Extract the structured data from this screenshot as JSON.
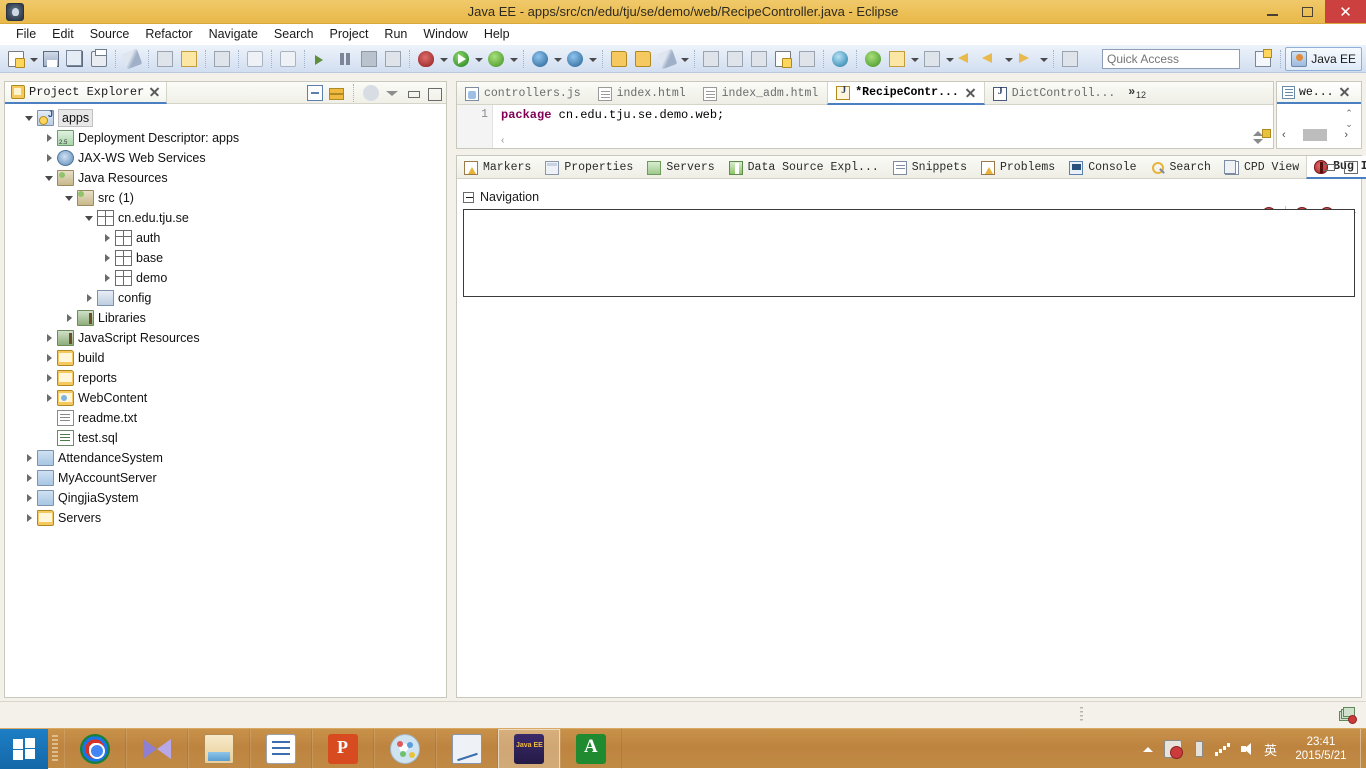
{
  "window": {
    "title": "Java EE - apps/src/cn/edu/tju/se/demo/web/RecipeController.java - Eclipse",
    "app_icon": "eclipse-icon",
    "minimize_label": "Minimize",
    "maximize_label": "Maximize",
    "close_label": "Close",
    "titlebar_color": "#ecc057",
    "close_button_color": "#cc4040"
  },
  "menubar": {
    "items": [
      {
        "label": "File"
      },
      {
        "label": "Edit"
      },
      {
        "label": "Source"
      },
      {
        "label": "Refactor"
      },
      {
        "label": "Navigate"
      },
      {
        "label": "Search"
      },
      {
        "label": "Project"
      },
      {
        "label": "Run"
      },
      {
        "label": "Window"
      },
      {
        "label": "Help"
      }
    ]
  },
  "toolbar": {
    "quick_access_placeholder": "Quick Access",
    "quick_access_value": "",
    "perspective_open_label": "Open Perspective",
    "perspective_current_label": "Java EE",
    "buttons": [
      {
        "name": "new-button",
        "icon": "new-wizard-icon"
      },
      {
        "name": "new-dropdown",
        "icon": "chevron-down-icon"
      },
      {
        "name": "save-button",
        "icon": "save-icon"
      },
      {
        "name": "save-all-button",
        "icon": "save-all-icon"
      },
      {
        "name": "print-button",
        "icon": "print-icon"
      },
      {
        "name": "toggle-mark-occurrences-button",
        "icon": "pen-strike-icon"
      },
      {
        "name": "new-java-package-button",
        "icon": "package-icon"
      },
      {
        "name": "new-java-class-button",
        "icon": "class-icon"
      },
      {
        "name": "open-type-button",
        "icon": "open-type-icon"
      },
      {
        "name": "undo-button",
        "icon": "undo-icon"
      },
      {
        "name": "redo-button",
        "icon": "redo-icon"
      },
      {
        "name": "resume-button",
        "icon": "resume-icon"
      },
      {
        "name": "suspend-button",
        "icon": "pause-icon"
      },
      {
        "name": "terminate-button",
        "icon": "stop-icon"
      },
      {
        "name": "step-button",
        "icon": "step-icon"
      },
      {
        "name": "debug-button",
        "icon": "debug-bug-icon"
      },
      {
        "name": "debug-dropdown",
        "icon": "chevron-down-icon"
      },
      {
        "name": "run-button",
        "icon": "run-play-icon"
      },
      {
        "name": "run-dropdown",
        "icon": "chevron-down-icon"
      },
      {
        "name": "run-external-tools-button",
        "icon": "external-tools-icon"
      },
      {
        "name": "external-tools-dropdown",
        "icon": "chevron-down-icon"
      },
      {
        "name": "new-server-button",
        "icon": "server-new-icon"
      },
      {
        "name": "server-dropdown",
        "icon": "chevron-down-icon"
      },
      {
        "name": "new-connection-button",
        "icon": "connection-icon"
      },
      {
        "name": "connection-dropdown",
        "icon": "chevron-down-icon"
      },
      {
        "name": "open-resource-button",
        "icon": "open-folder-icon"
      },
      {
        "name": "folder-button",
        "icon": "folder-icon"
      },
      {
        "name": "search-wand-button",
        "icon": "wand-icon"
      },
      {
        "name": "wand-dropdown",
        "icon": "chevron-down-icon"
      },
      {
        "name": "next-annotation-button",
        "icon": "next-annotation-icon"
      },
      {
        "name": "previous-annotation-button",
        "icon": "previous-annotation-icon"
      },
      {
        "name": "last-edit-location-button",
        "icon": "last-edit-icon"
      },
      {
        "name": "toggle-block-selection-button",
        "icon": "block-selection-icon"
      },
      {
        "name": "show-whitespace-button",
        "icon": "whitespace-icon"
      },
      {
        "name": "web-browser-button",
        "icon": "globe-icon"
      },
      {
        "name": "validate-button",
        "icon": "validate-icon"
      },
      {
        "name": "report-button",
        "icon": "report-icon"
      },
      {
        "name": "report-dropdown",
        "icon": "chevron-down-icon"
      },
      {
        "name": "pin-editor-button",
        "icon": "pin-icon"
      },
      {
        "name": "pin-dropdown",
        "icon": "chevron-down-icon"
      },
      {
        "name": "back-button",
        "icon": "arrow-left-icon"
      },
      {
        "name": "forward-button",
        "icon": "arrow-right-icon"
      },
      {
        "name": "forward-dropdown",
        "icon": "chevron-down-icon"
      },
      {
        "name": "next-button",
        "icon": "arrow-right-pale-icon"
      },
      {
        "name": "next-dropdown",
        "icon": "chevron-down-icon"
      },
      {
        "name": "open-task-button",
        "icon": "task-icon"
      }
    ]
  },
  "project_explorer": {
    "title": "Project Explorer",
    "tools": [
      {
        "name": "collapse-all-button",
        "icon": "collapse-all-icon"
      },
      {
        "name": "link-with-editor-button",
        "icon": "link-editor-icon"
      },
      {
        "name": "filter-button",
        "icon": "filter-icon"
      },
      {
        "name": "view-menu-button",
        "icon": "chevron-down-icon"
      },
      {
        "name": "minimize-view-button",
        "icon": "minimize-icon"
      },
      {
        "name": "maximize-view-button",
        "icon": "maximize-icon"
      }
    ],
    "tree": [
      {
        "label": "apps",
        "indent": 0,
        "twisty": "expanded",
        "icon": "java-project-icon",
        "selected": true
      },
      {
        "label": "Deployment Descriptor: apps",
        "indent": 1,
        "twisty": "collapsed",
        "icon": "deployment-descriptor-icon"
      },
      {
        "label": "JAX-WS Web Services",
        "indent": 1,
        "twisty": "collapsed",
        "icon": "jaxws-icon"
      },
      {
        "label": "Java Resources",
        "indent": 1,
        "twisty": "expanded",
        "icon": "java-resources-icon"
      },
      {
        "label": "src",
        "count": "(1)",
        "indent": 2,
        "twisty": "expanded",
        "icon": "source-folder-icon"
      },
      {
        "label": "cn.edu.tju.se",
        "indent": 3,
        "twisty": "expanded",
        "icon": "package-icon"
      },
      {
        "label": "auth",
        "indent": 4,
        "twisty": "collapsed",
        "icon": "package-icon"
      },
      {
        "label": "base",
        "indent": 4,
        "twisty": "collapsed",
        "icon": "package-icon"
      },
      {
        "label": "demo",
        "indent": 4,
        "twisty": "collapsed",
        "icon": "package-icon"
      },
      {
        "label": "config",
        "indent": 3,
        "twisty": "collapsed",
        "icon": "config-package-icon"
      },
      {
        "label": "Libraries",
        "indent": 2,
        "twisty": "collapsed",
        "icon": "libraries-icon"
      },
      {
        "label": "JavaScript Resources",
        "indent": 1,
        "twisty": "collapsed",
        "icon": "libraries-icon"
      },
      {
        "label": "build",
        "indent": 1,
        "twisty": "collapsed",
        "icon": "folder-icon"
      },
      {
        "label": "reports",
        "indent": 1,
        "twisty": "collapsed",
        "icon": "folder-icon"
      },
      {
        "label": "WebContent",
        "indent": 1,
        "twisty": "collapsed",
        "icon": "web-folder-icon"
      },
      {
        "label": "readme.txt",
        "indent": 1,
        "twisty": "none",
        "icon": "text-file-icon"
      },
      {
        "label": "test.sql",
        "indent": 1,
        "twisty": "none",
        "icon": "sql-file-icon"
      },
      {
        "label": "AttendanceSystem",
        "indent": 0,
        "twisty": "collapsed",
        "icon": "closed-project-icon"
      },
      {
        "label": "MyAccountServer",
        "indent": 0,
        "twisty": "collapsed",
        "icon": "closed-project-icon"
      },
      {
        "label": "QingjiaSystem",
        "indent": 0,
        "twisty": "collapsed",
        "icon": "closed-project-icon"
      },
      {
        "label": "Servers",
        "indent": 0,
        "twisty": "collapsed",
        "icon": "servers-folder-icon"
      }
    ]
  },
  "editor": {
    "tabs": [
      {
        "label": "controllers.js",
        "icon": "js-file-icon",
        "active": false
      },
      {
        "label": "index.html",
        "icon": "html-file-icon",
        "active": false
      },
      {
        "label": "index_adm.html",
        "icon": "html-file-icon",
        "active": false
      },
      {
        "label": "*RecipeContr...",
        "icon": "java-file-dirty-icon",
        "active": true
      },
      {
        "label": "DictControll...",
        "icon": "java-file-icon",
        "active": false
      }
    ],
    "overflow_symbol": "»",
    "overflow_count": "12",
    "line_number": "1",
    "code_keyword": "package",
    "code_rest": " cn.edu.tju.se.demo.web;",
    "hscroll_glyph": "‹"
  },
  "right_view": {
    "tab_label": "we...",
    "tab_icon": "text-file-icon",
    "scroll_up": "⌃",
    "scroll_down": "⌄",
    "scroll_left": "‹",
    "scroll_right": "›"
  },
  "bottom_panel": {
    "tabs": [
      {
        "label": "Markers",
        "icon": "markers-icon",
        "active": false
      },
      {
        "label": "Properties",
        "icon": "properties-icon",
        "active": false
      },
      {
        "label": "Servers",
        "icon": "servers-icon",
        "active": false
      },
      {
        "label": "Data Source Expl...",
        "icon": "data-source-icon",
        "active": false
      },
      {
        "label": "Snippets",
        "icon": "snippets-icon",
        "active": false
      },
      {
        "label": "Problems",
        "icon": "problems-icon",
        "active": false
      },
      {
        "label": "Console",
        "icon": "console-icon",
        "active": false
      },
      {
        "label": "Search",
        "icon": "search-icon",
        "active": false
      },
      {
        "label": "CPD View",
        "icon": "cpd-view-icon",
        "active": false
      },
      {
        "label": "Bug Info",
        "icon": "bug-icon",
        "active": true
      }
    ],
    "view_tools": [
      {
        "name": "minimize-view-button",
        "icon": "minimize-icon"
      },
      {
        "name": "maximize-view-button",
        "icon": "maximize-icon"
      }
    ],
    "content_toolbar": [
      {
        "name": "bug-filter-button",
        "icon": "bug-icon"
      },
      {
        "name": "bug-prev-button",
        "icon": "bug-icon"
      },
      {
        "name": "bug-next-button",
        "icon": "bug-icon"
      },
      {
        "name": "view-menu-button",
        "icon": "chevron-down-icon"
      }
    ],
    "navigation_section_label": "Navigation",
    "navigation_content": ""
  },
  "status_bar": {
    "stack_icon": "layers-error-icon"
  },
  "taskbar": {
    "start_label": "Start",
    "items": [
      {
        "name": "taskbar-chrome",
        "icon": "chrome-icon",
        "active": false
      },
      {
        "name": "taskbar-media-player",
        "icon": "media-player-icon",
        "active": false
      },
      {
        "name": "taskbar-file-explorer",
        "icon": "file-explorer-icon",
        "active": false
      },
      {
        "name": "taskbar-notes",
        "icon": "notes-icon",
        "active": false
      },
      {
        "name": "taskbar-powerpoint",
        "icon": "powerpoint-icon",
        "active": false
      },
      {
        "name": "taskbar-paint",
        "icon": "paint-icon",
        "active": false
      },
      {
        "name": "taskbar-chart-app",
        "icon": "chart-app-icon",
        "active": false
      },
      {
        "name": "taskbar-eclipse",
        "icon": "eclipse-javaee-icon",
        "active": true
      },
      {
        "name": "taskbar-android-studio",
        "icon": "android-icon",
        "active": false
      }
    ],
    "tray": [
      {
        "name": "tray-show-hidden",
        "icon": "triangle-up-icon"
      },
      {
        "name": "tray-security",
        "icon": "shield-error-icon"
      },
      {
        "name": "tray-usb",
        "icon": "usb-icon"
      },
      {
        "name": "tray-network",
        "icon": "signal-bars-icon"
      },
      {
        "name": "tray-volume",
        "icon": "volume-icon"
      }
    ],
    "ime_label": "英",
    "clock_time": "23:41",
    "clock_date": "2015/5/21"
  }
}
